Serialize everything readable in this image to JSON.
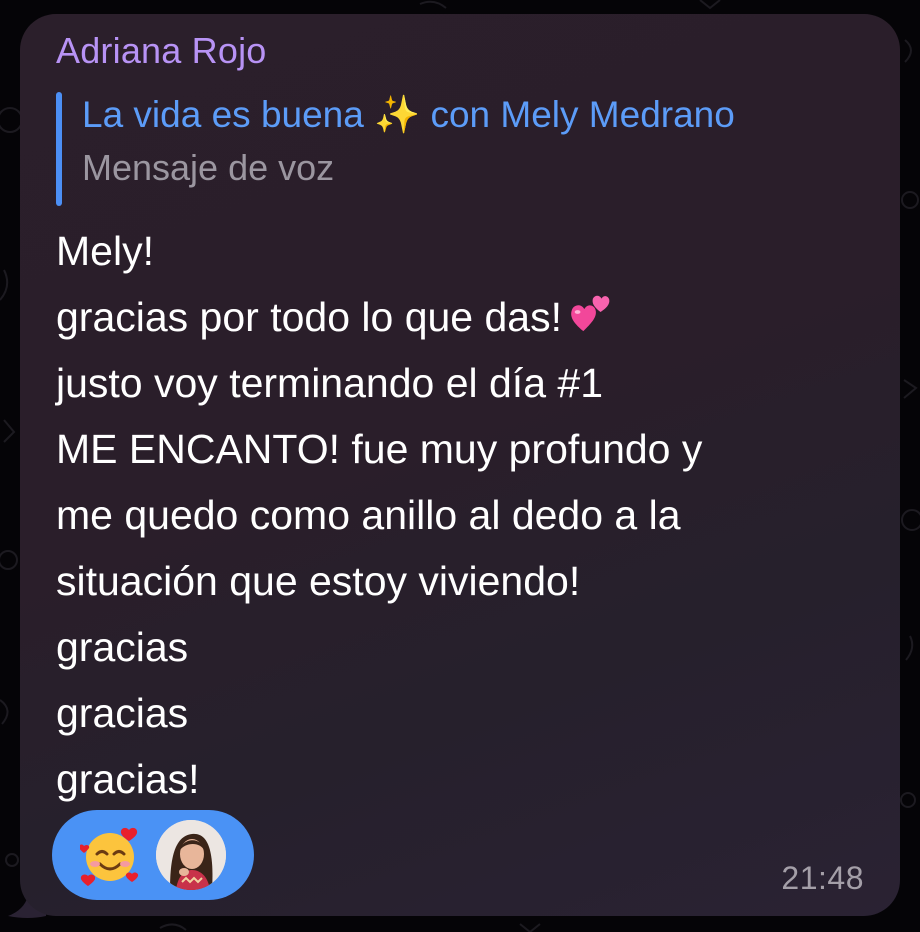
{
  "message": {
    "sender": "Adriana Rojo",
    "reply": {
      "title": "La vida es buena ✨ con Mely Medrano",
      "subtitle": "Mensaje de voz"
    },
    "lines": [
      "Mely!",
      "gracias por todo lo que das!",
      "justo voy terminando el día #1",
      "ME ENCANTO! fue muy profundo y",
      "me quedo como anillo al dedo a la",
      "situación que estoy viviendo!",
      "gracias",
      "gracias",
      "gracias!"
    ],
    "inline_emoji": "two-hearts-icon",
    "time": "21:48",
    "reactions": {
      "emoji": "smiling-face-with-hearts-icon",
      "reactor": "avatar"
    }
  },
  "colors": {
    "sender": "#b893f5",
    "reply_accent": "#4c8ff5",
    "reaction_pill": "#4a92f5",
    "bubble": "#2b1f2b",
    "text": "#ffffff"
  }
}
